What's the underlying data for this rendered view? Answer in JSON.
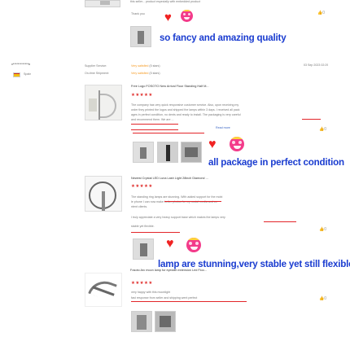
{
  "review1": {
    "top_text": "this seller... product especially with embedded product",
    "user_text": "Thank you",
    "likes": "0",
    "big_caption": "so fancy and amazing quality"
  },
  "review2": {
    "reviewer": "v*************n",
    "country": "Spain",
    "supplier_label": "Supplier Service:",
    "supplier_value": "Very satisfied",
    "supplier_score": "(5 stars)",
    "shipment_label": "On-time Shipment:",
    "shipment_value": "Very satisfied",
    "shipment_score": "(5 stars)",
    "date": "03 Sep 2023 02:29",
    "product": "Free Logo FOSOTO New Arrival Floor Standing Half M...",
    "stars": "★★★★★",
    "lines": [
      "The company has very quick responsive customer service. Also, upon receiving my",
      "order they printed the logos and shipped the lamps within 3 days. I received all pack",
      "ages in perfect condition, no dents and ready to install. The packaging is very careful",
      "and recommend them. We are ..."
    ],
    "read_more": "Read more",
    "likes": "0",
    "big_caption": "all package in perfect condition"
  },
  "review3": {
    "product": "Newest Crystal LED Luna Lash Light 28inch Diamond ...",
    "stars": "★★★★★",
    "lines": [
      "The standing ring lamps are stunning. With added support for the mobi",
      "le phone I can now make better photos for my social media and co",
      "ntent clients.",
      "I truly appreciate a very heavy support base which makes the lamps very",
      "stable yet flexible."
    ],
    "likes": "0",
    "big_caption": "lamp are stunning,very stable yet still flexible"
  },
  "review4": {
    "product": "Fosoto Arc moon lamp for eyelash extension Led Floo...",
    "stars": "★★★★★",
    "lines": [
      "very happy with this moonlight",
      "fast response from seller and shipping went perfect"
    ],
    "likes": "0"
  },
  "colors": {
    "accent_blue": "#1a3cd0",
    "underline_red": "#e3262a",
    "star_red": "#e0312f",
    "link_orange": "#f59a23"
  },
  "icons": {
    "heart": "heart-icon",
    "emoji": "heart-eyes-face-icon",
    "like": "thumbs-up-icon",
    "flag": "spain-flag-icon"
  }
}
